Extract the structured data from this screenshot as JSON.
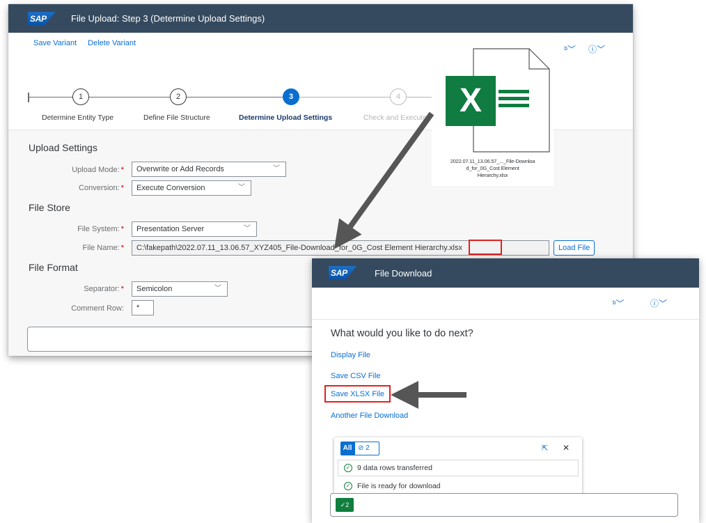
{
  "main": {
    "logo": "SAP",
    "title": "File Upload: Step 3  (Determine Upload Settings)",
    "toolbar": {
      "save_variant": "Save Variant",
      "delete_variant": "Delete Variant"
    },
    "steps": [
      {
        "num": "1",
        "label": "Determine Entity Type"
      },
      {
        "num": "2",
        "label": "Define File Structure"
      },
      {
        "num": "3",
        "label": "Determine Upload Settings"
      },
      {
        "num": "4",
        "label": "Check and Execute"
      }
    ],
    "upload_settings": {
      "heading": "Upload Settings",
      "upload_mode_label": "Upload Mode:",
      "upload_mode_value": "Overwrite or Add Records",
      "conversion_label": "Conversion:",
      "conversion_value": "Execute Conversion"
    },
    "file_store": {
      "heading": "File Store",
      "file_system_label": "File System:",
      "file_system_value": "Presentation Server",
      "file_name_label": "File Name:",
      "file_name_value": "C:\\fakepath\\2022.07.11_13.06.57_XYZ405_File-Download_for_0G_Cost Element Hierarchy.xlsx",
      "load_file": "Load File"
    },
    "file_format": {
      "heading": "File Format",
      "separator_label": "Separator:",
      "separator_value": "Semicolon",
      "comment_label": "Comment Row:",
      "comment_value": "*"
    }
  },
  "excel_file": {
    "caption_line1": "2022.07.11_13.06.57_..._File-Downloa",
    "caption_line2": "d_for_0G_Cost Element",
    "caption_line3": "Hierarchy.xlsx",
    "icon_letter": "X"
  },
  "dialog": {
    "logo": "SAP",
    "title": "File Download",
    "question": "What would you like to do next?",
    "links": [
      "Display File",
      "Save CSV File",
      "Save XLSX File",
      "Another File Download"
    ],
    "messages": {
      "all": "All",
      "count": "2",
      "rows": [
        "9 data rows transferred",
        "File is ready for download"
      ]
    },
    "footer_count": "2"
  },
  "colors": {
    "shell": "#354a5f",
    "link": "#0a6ed1",
    "highlight": "#e0221e",
    "success": "#107e3e",
    "excel": "#107c41"
  }
}
